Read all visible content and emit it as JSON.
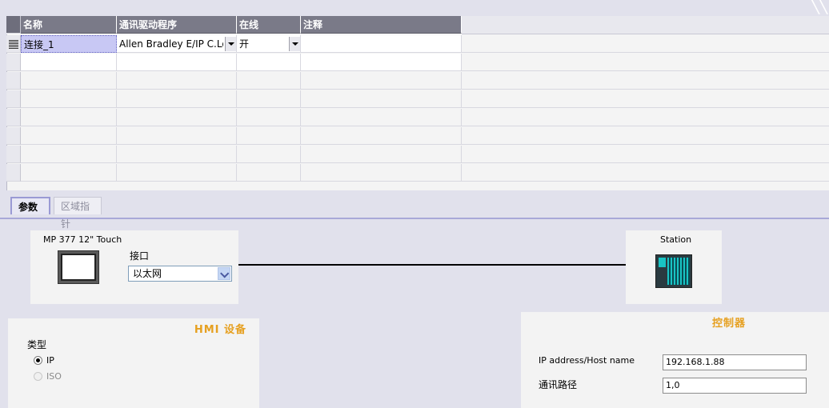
{
  "grid": {
    "columns": [
      "名称",
      "通讯驱动程序",
      "在线",
      "注释"
    ],
    "rows": [
      {
        "name": "连接_1",
        "driver": "Allen Bradley E/IP C.Logix",
        "online": "开",
        "comment": ""
      }
    ]
  },
  "tabs": [
    {
      "label": "参数",
      "active": true
    },
    {
      "label": "区域指针",
      "active": false
    }
  ],
  "hmi_device_box": {
    "title": "MP 377 12\" Touch",
    "interface_label": "接口",
    "interface_value": "以太网"
  },
  "station_box": {
    "title": "Station"
  },
  "hmi_panel": {
    "title": "HMI 设备",
    "type_label": "类型",
    "options": [
      {
        "label": "IP",
        "selected": true,
        "enabled": true
      },
      {
        "label": "ISO",
        "selected": false,
        "enabled": false
      }
    ]
  },
  "controller_panel": {
    "title": "控制器",
    "ip_label": "IP address/Host name",
    "ip_value": "192.168.1.88",
    "path_label": "通讯路径",
    "path_value": "1,0"
  },
  "colors": {
    "header_bg": "#7a7a88",
    "accent_orange": "#e6a020",
    "tab_border": "#9a9ad4"
  }
}
